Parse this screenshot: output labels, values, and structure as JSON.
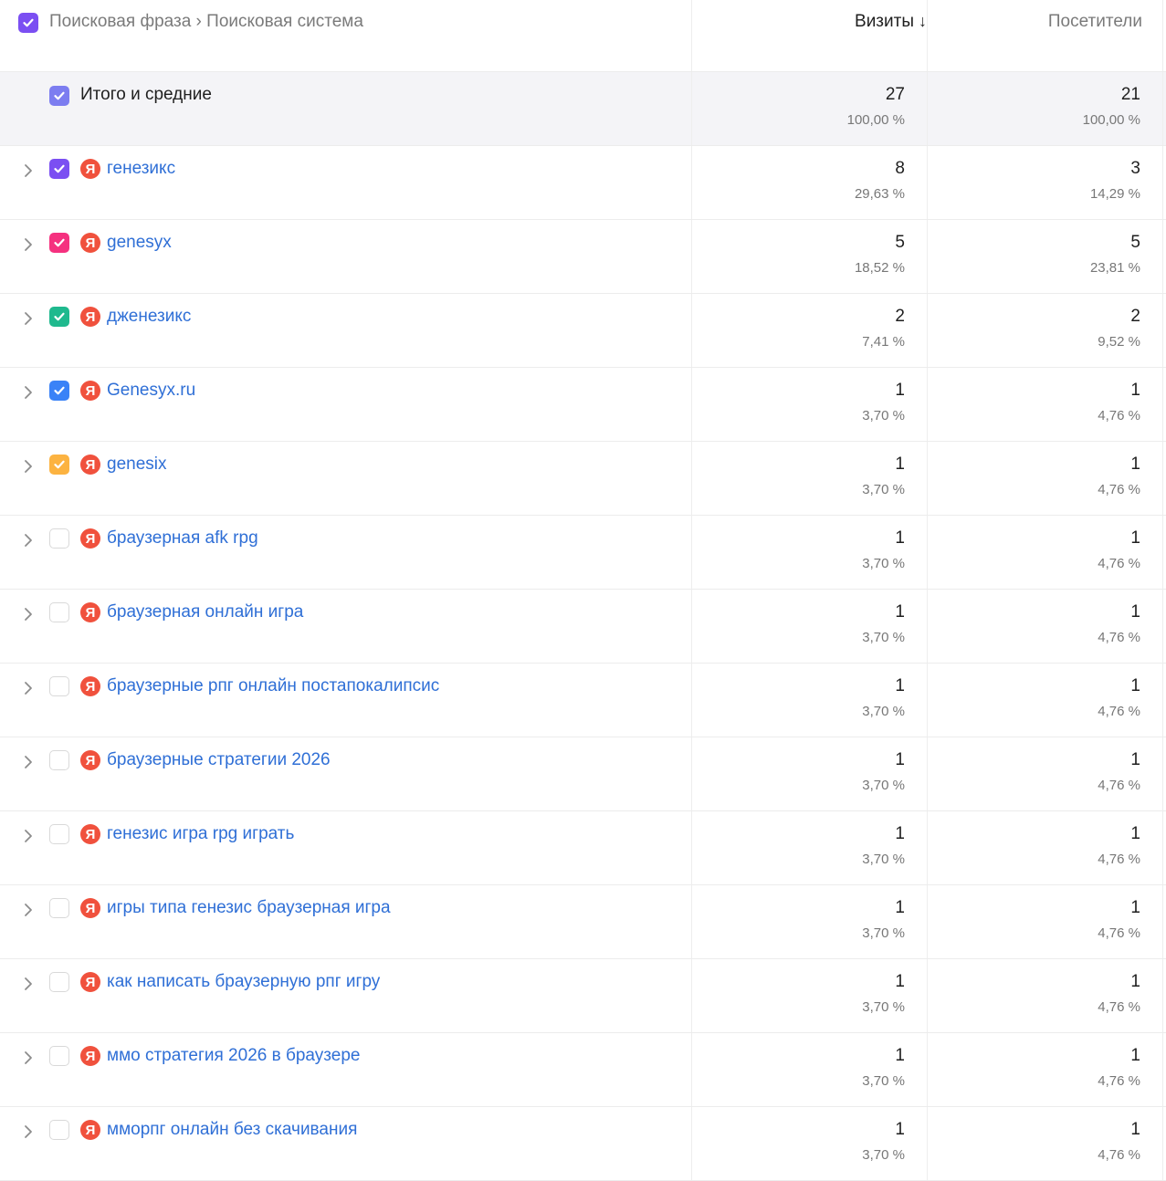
{
  "header": {
    "dimensions_label": "Поисковая фраза › Поисковая система",
    "visits_label": "Визиты",
    "visits_sort": "↓",
    "visitors_label": "Посетители",
    "checkbox_color": "#7b4ff2"
  },
  "total": {
    "label": "Итого и средние",
    "visits": "27",
    "visits_pct": "100,00 %",
    "visitors": "21",
    "visitors_pct": "100,00 %",
    "checkbox_color": "#7c7df0"
  },
  "rows": [
    {
      "phrase": "генезикс",
      "visits": "8",
      "visits_pct": "29,63 %",
      "visitors": "3",
      "visitors_pct": "14,29 %",
      "checked": true,
      "color": "#7b4ff2"
    },
    {
      "phrase": "genesyx",
      "visits": "5",
      "visits_pct": "18,52 %",
      "visitors": "5",
      "visitors_pct": "23,81 %",
      "checked": true,
      "color": "#f5317f"
    },
    {
      "phrase": "дженезикс",
      "visits": "2",
      "visits_pct": "7,41 %",
      "visitors": "2",
      "visitors_pct": "9,52 %",
      "checked": true,
      "color": "#1fb98e"
    },
    {
      "phrase": "Genesyx.ru",
      "visits": "1",
      "visits_pct": "3,70 %",
      "visitors": "1",
      "visitors_pct": "4,76 %",
      "checked": true,
      "color": "#3a82f7"
    },
    {
      "phrase": "genesix",
      "visits": "1",
      "visits_pct": "3,70 %",
      "visitors": "1",
      "visitors_pct": "4,76 %",
      "checked": true,
      "color": "#fcb341"
    },
    {
      "phrase": "браузерная afk rpg",
      "visits": "1",
      "visits_pct": "3,70 %",
      "visitors": "1",
      "visitors_pct": "4,76 %",
      "checked": false
    },
    {
      "phrase": "браузерная онлайн игра",
      "visits": "1",
      "visits_pct": "3,70 %",
      "visitors": "1",
      "visitors_pct": "4,76 %",
      "checked": false
    },
    {
      "phrase": "браузерные рпг онлайн постапокалипсис",
      "visits": "1",
      "visits_pct": "3,70 %",
      "visitors": "1",
      "visitors_pct": "4,76 %",
      "checked": false
    },
    {
      "phrase": "браузерные стратегии 2026",
      "visits": "1",
      "visits_pct": "3,70 %",
      "visitors": "1",
      "visitors_pct": "4,76 %",
      "checked": false
    },
    {
      "phrase": "генезис игра rpg играть",
      "visits": "1",
      "visits_pct": "3,70 %",
      "visitors": "1",
      "visitors_pct": "4,76 %",
      "checked": false
    },
    {
      "phrase": "игры типа генезис браузерная игра",
      "visits": "1",
      "visits_pct": "3,70 %",
      "visitors": "1",
      "visitors_pct": "4,76 %",
      "checked": false
    },
    {
      "phrase": "как написать браузерную рпг игру",
      "visits": "1",
      "visits_pct": "3,70 %",
      "visitors": "1",
      "visitors_pct": "4,76 %",
      "checked": false
    },
    {
      "phrase": "ммо стратегия 2026 в браузере",
      "visits": "1",
      "visits_pct": "3,70 %",
      "visitors": "1",
      "visitors_pct": "4,76 %",
      "checked": false
    },
    {
      "phrase": "мморпг онлайн без скачивания",
      "visits": "1",
      "visits_pct": "3,70 %",
      "visitors": "1",
      "visitors_pct": "4,76 %",
      "checked": false
    }
  ],
  "search_engine_icon": {
    "name": "yandex-icon",
    "glyph": "Я",
    "color": "#f0513d"
  },
  "chevron_icon": "chevron-right-icon"
}
